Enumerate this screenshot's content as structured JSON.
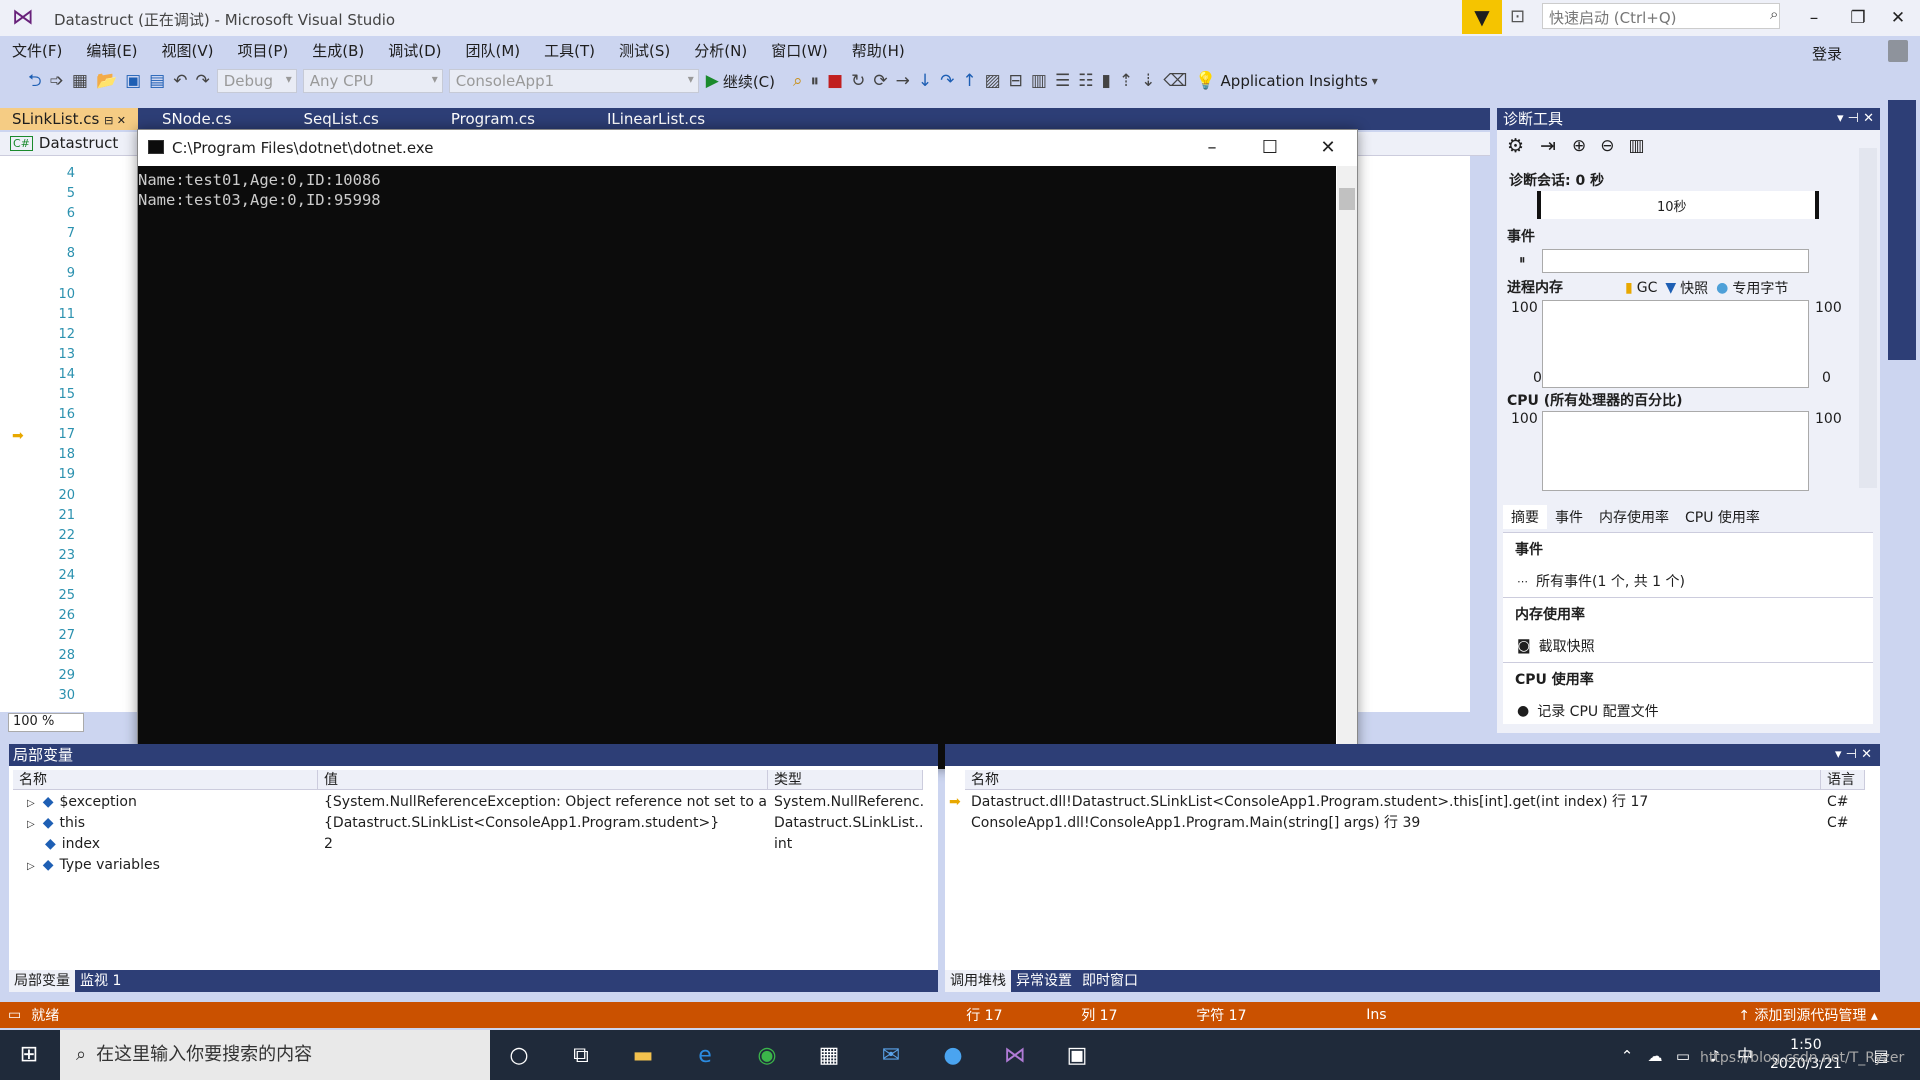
{
  "window": {
    "title": "Datastruct (正在调试) - Microsoft Visual Studio",
    "quick_launch_placeholder": "快速启动 (Ctrl+Q)",
    "login": "登录"
  },
  "menu": [
    "文件(F)",
    "编辑(E)",
    "视图(V)",
    "项目(P)",
    "生成(B)",
    "调试(D)",
    "团队(M)",
    "工具(T)",
    "测试(S)",
    "分析(N)",
    "窗口(W)",
    "帮助(H)"
  ],
  "toolbar": {
    "config": "Debug",
    "platform": "Any CPU",
    "startup": "ConsoleApp1",
    "continue": "继续(C)",
    "app_insights": "Application Insights"
  },
  "editor": {
    "tabs": [
      "SLinkList.cs",
      "SNode.cs",
      "SeqList.cs",
      "Program.cs",
      "ILinearList.cs"
    ],
    "project": "Datastruct",
    "line_numbers": [
      "4",
      "5",
      "6",
      "7",
      "8",
      "9",
      "10",
      "11",
      "12",
      "13",
      "14",
      "15",
      "16",
      "17",
      "18",
      "19",
      "20",
      "21",
      "22",
      "23",
      "24",
      "25",
      "26",
      "27",
      "28",
      "29",
      "30"
    ],
    "zoom": "100 %"
  },
  "console": {
    "title": "C:\\Program Files\\dotnet\\dotnet.exe",
    "lines": [
      "Name:test01,Age:0,ID:10086",
      "Name:test03,Age:0,ID:95998"
    ]
  },
  "diagnostics": {
    "title": "诊断工具",
    "session": "诊断会话: 0 秒",
    "timeline_label": "10秒",
    "events_label": "事件",
    "memory_label": "进程内存",
    "gc": "GC",
    "snapshot": "快照",
    "private_bytes": "专用字节",
    "cpu_label": "CPU (所有处理器的百分比)",
    "axis_max": "100",
    "axis_min": "0",
    "tabs": [
      "摘要",
      "事件",
      "内存使用率",
      "CPU 使用率"
    ],
    "sections": [
      {
        "title": "事件",
        "entry": "所有事件(1 个, 共 1 个)"
      },
      {
        "title": "内存使用率",
        "entry": "截取快照"
      },
      {
        "title": "CPU 使用率",
        "entry": "记录 CPU 配置文件"
      }
    ]
  },
  "locals": {
    "title": "局部变量",
    "headers": [
      "名称",
      "值",
      "类型"
    ],
    "rows": [
      {
        "name": "$exception",
        "value": "{System.NullReferenceException: Object reference not set to an in...",
        "type": "System.NullReferenc..."
      },
      {
        "name": "this",
        "value": "{Datastruct.SLinkList<ConsoleApp1.Program.student>}",
        "type": "Datastruct.SLinkList..."
      },
      {
        "name": "index",
        "value": "2",
        "type": "int"
      },
      {
        "name": "Type variables",
        "value": "",
        "type": ""
      }
    ],
    "tabs": [
      "局部变量",
      "监视 1"
    ]
  },
  "callstack": {
    "headers": [
      "名称",
      "语言"
    ],
    "rows": [
      {
        "name": "Datastruct.dll!Datastruct.SLinkList<ConsoleApp1.Program.student>.this[int].get(int index) 行 17",
        "lang": "C#"
      },
      {
        "name": "ConsoleApp1.dll!ConsoleApp1.Program.Main(string[] args) 行 39",
        "lang": "C#"
      }
    ],
    "tabs": [
      "调用堆栈",
      "异常设置",
      "即时窗口"
    ]
  },
  "status": {
    "ready": "就绪",
    "line": "行 17",
    "col": "列 17",
    "char": "字符 17",
    "ins": "Ins",
    "source": "添加到源代码管理"
  },
  "taskbar": {
    "search_placeholder": "在这里输入你要搜索的内容",
    "time": "1:50",
    "date": "2020/3/21",
    "ime": "中",
    "watermark": "https://blog.csdn.net/T_Ryzer"
  },
  "colors": {
    "accent": "#2d3e76",
    "status": "#ca5100",
    "tab_active": "#f5cc84"
  }
}
